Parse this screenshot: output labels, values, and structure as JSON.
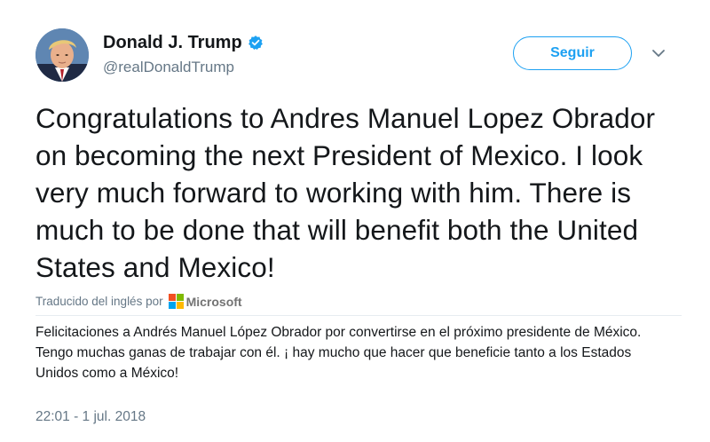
{
  "user": {
    "display_name": "Donald J. Trump",
    "handle": "@realDonaldTrump",
    "verified": true,
    "verified_icon": "verified-badge-icon",
    "avatar_icon": "profile-photo"
  },
  "actions": {
    "follow_label": "Seguir",
    "menu_icon": "chevron-down-icon"
  },
  "tweet": {
    "text": "Congratulations to Andres Manuel Lopez Obrador on becoming the next President of Mexico. I look very much forward to working with him. There is much to be done that will benefit both the United States and Mexico!"
  },
  "translation": {
    "label": "Traducido del inglés por",
    "provider": "Microsoft",
    "provider_icon": "microsoft-logo-icon",
    "text": "Felicitaciones a Andrés Manuel López Obrador por convertirse en el próximo presidente de México. Tengo muchas ganas de trabajar con él. ¡ hay mucho que hacer que beneficie tanto a los Estados Unidos como a México!"
  },
  "meta": {
    "timestamp": "22:01 - 1 jul. 2018"
  },
  "colors": {
    "accent": "#1da1f2",
    "text": "#14171a",
    "secondary_text": "#657786",
    "divider": "#e6ecf0",
    "ms_red": "#f25022",
    "ms_green": "#7fba00",
    "ms_blue": "#00a4ef",
    "ms_yellow": "#ffb900"
  }
}
